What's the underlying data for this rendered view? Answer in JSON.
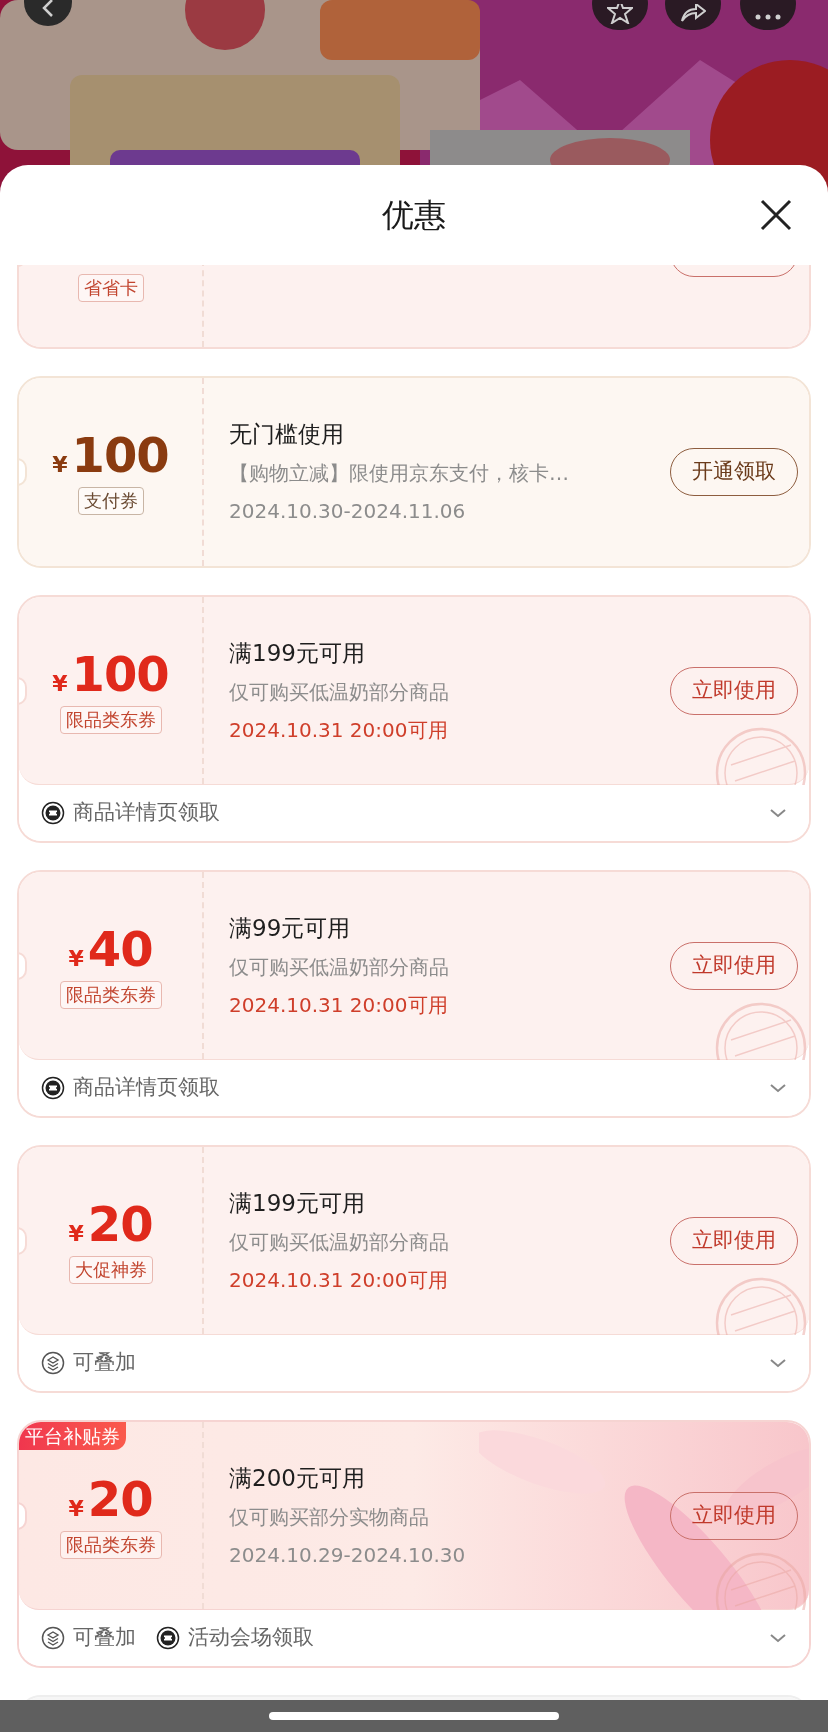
{
  "sheet": {
    "title": "优惠"
  },
  "coupons": [
    {
      "kind": "red",
      "cut_top": true,
      "tag": "省省卡"
    },
    {
      "kind": "brown",
      "symbol": "¥",
      "amount": "100",
      "tag": "支付券",
      "title": "无门槛使用",
      "description": "【购物立减】限使用京东支付，核卡…",
      "validity": "2024.10.30-2024.11.06",
      "validity_highlight": false,
      "button": "开通领取",
      "claimed": false
    },
    {
      "kind": "red",
      "symbol": "¥",
      "amount": "100",
      "tag": "限品类东券",
      "title": "满199元可用",
      "description": "仅可购买低温奶部分商品",
      "validity": "2024.10.31 20:00可用",
      "validity_highlight": true,
      "button": "立即使用",
      "claimed": true,
      "footer": [
        {
          "kind": "source",
          "text": "商品详情页领取"
        }
      ]
    },
    {
      "kind": "red",
      "symbol": "¥",
      "amount": "40",
      "tag": "限品类东券",
      "title": "满99元可用",
      "description": "仅可购买低温奶部分商品",
      "validity": "2024.10.31 20:00可用",
      "validity_highlight": true,
      "button": "立即使用",
      "claimed": true,
      "footer": [
        {
          "kind": "source",
          "text": "商品详情页领取"
        }
      ]
    },
    {
      "kind": "red",
      "symbol": "¥",
      "amount": "20",
      "tag": "大促神券",
      "title": "满199元可用",
      "description": "仅可购买低温奶部分商品",
      "validity": "2024.10.31 20:00可用",
      "validity_highlight": true,
      "button": "立即使用",
      "claimed": true,
      "footer": [
        {
          "kind": "stackable",
          "text": "可叠加"
        }
      ]
    },
    {
      "kind": "subsidy",
      "badge": "平台补贴券",
      "symbol": "¥",
      "amount": "20",
      "tag": "限品类东券",
      "title": "满200元可用",
      "description": "仅可购买部分实物商品",
      "validity": "2024.10.29-2024.10.30",
      "validity_highlight": false,
      "button": "立即使用",
      "claimed": true,
      "footer": [
        {
          "kind": "stackable",
          "text": "可叠加"
        },
        {
          "kind": "source",
          "text": "活动会场领取"
        }
      ]
    },
    {
      "kind": "gray",
      "cut_bottom": true
    }
  ]
}
